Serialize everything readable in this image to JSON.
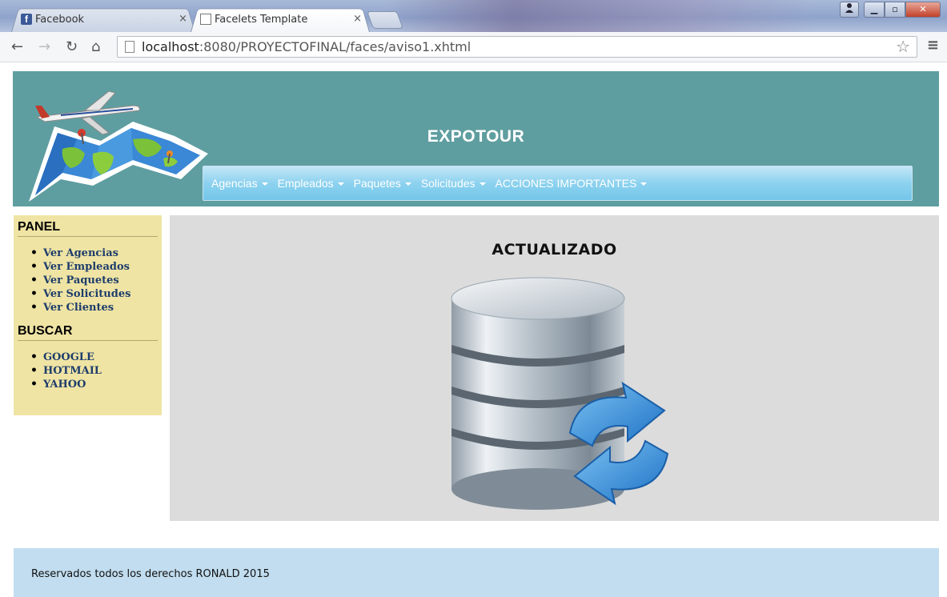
{
  "browser": {
    "tabs": [
      {
        "title": "Facebook",
        "icon": "facebook-icon",
        "active": false
      },
      {
        "title": "Facelets Template",
        "icon": "document-icon",
        "active": true
      }
    ],
    "close_glyph": "×",
    "url_host": "localhost",
    "url_path": ":8080/PROYECTOFINAL/faces/aviso1.xhtml"
  },
  "header": {
    "title": "EXPOTOUR",
    "background_color": "#5f9ea0",
    "nav": [
      {
        "label": "Agencias"
      },
      {
        "label": "Empleados"
      },
      {
        "label": "Paquetes"
      },
      {
        "label": "Solicitudes"
      },
      {
        "label": "ACCIONES IMPORTANTES"
      }
    ]
  },
  "sidebar": {
    "panel_title": "PANEL",
    "panel_links": [
      "Ver Agencias",
      "Ver Empleados",
      "Ver Paquetes",
      "Ver Solicitudes",
      "Ver Clientes"
    ],
    "search_title": "BUSCAR",
    "search_links": [
      "GOOGLE",
      "HOTMAIL",
      "YAHOO"
    ],
    "background_color": "#efe4a4"
  },
  "main": {
    "heading": "ACTUALIZADO",
    "illustration": "database-refresh-icon"
  },
  "footer": {
    "text": "Reservados todos los derechos RONALD 2015",
    "background_color": "#c1ddef"
  }
}
